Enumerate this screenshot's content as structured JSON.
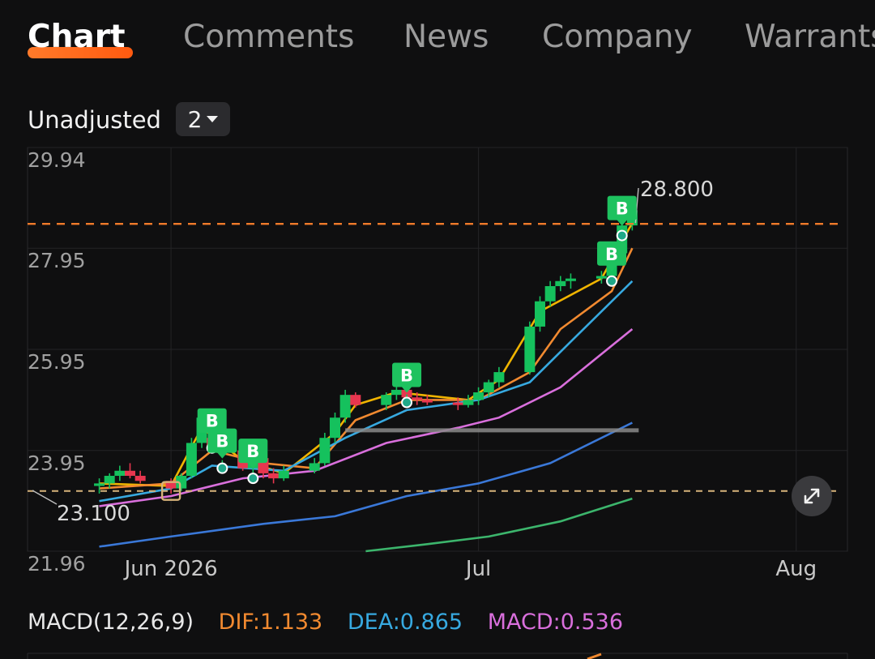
{
  "tabs": [
    {
      "label": "Chart",
      "active": true
    },
    {
      "label": "Comments",
      "active": false
    },
    {
      "label": "News",
      "active": false
    },
    {
      "label": "Company",
      "active": false
    },
    {
      "label": "Warrants",
      "active": false
    }
  ],
  "adjustment": {
    "label": "Unadjusted",
    "period": "2"
  },
  "chart_data": {
    "type": "candlestick",
    "y_axis_ticks": [
      "29.94",
      "27.95",
      "25.95",
      "23.95",
      "21.96"
    ],
    "ylim": [
      21.96,
      29.94
    ],
    "x_axis_ticks": [
      {
        "label": "Jun 2026",
        "x": "2026-06-01"
      },
      {
        "label": "Jul",
        "x": "2026-07-01"
      },
      {
        "label": "Aug",
        "x": "2026-08-01"
      }
    ],
    "high_marker": {
      "label": "28.800",
      "value": 28.8
    },
    "low_marker": {
      "label": "23.100",
      "value": 23.1
    },
    "current_level_line": 23.15,
    "support_line": 24.35,
    "buy_signal_label": "B",
    "buy_signals": [
      {
        "date": "2026-06-05",
        "price": 24.0
      },
      {
        "date": "2026-06-06",
        "price": 23.6
      },
      {
        "date": "2026-06-09",
        "price": 23.4
      },
      {
        "date": "2026-06-24",
        "price": 24.9
      },
      {
        "date": "2026-07-14",
        "price": 27.3
      },
      {
        "date": "2026-07-15",
        "price": 28.2
      }
    ],
    "candles": [
      {
        "date": "2026-05-25",
        "open": 23.25,
        "high": 23.4,
        "low": 23.1,
        "close": 23.3
      },
      {
        "date": "2026-05-26",
        "open": 23.3,
        "high": 23.5,
        "low": 23.2,
        "close": 23.45
      },
      {
        "date": "2026-05-27",
        "open": 23.45,
        "high": 23.65,
        "low": 23.35,
        "close": 23.55
      },
      {
        "date": "2026-05-28",
        "open": 23.55,
        "high": 23.7,
        "low": 23.4,
        "close": 23.45
      },
      {
        "date": "2026-05-29",
        "open": 23.45,
        "high": 23.55,
        "low": 23.3,
        "close": 23.35
      },
      {
        "date": "2026-06-01",
        "open": 23.35,
        "high": 23.4,
        "low": 23.1,
        "close": 23.2
      },
      {
        "date": "2026-06-02",
        "open": 23.2,
        "high": 23.5,
        "low": 23.15,
        "close": 23.45
      },
      {
        "date": "2026-06-03",
        "open": 23.45,
        "high": 24.2,
        "low": 23.4,
        "close": 24.1
      },
      {
        "date": "2026-06-04",
        "open": 24.1,
        "high": 24.75,
        "low": 24.0,
        "close": 24.6
      },
      {
        "date": "2026-06-05",
        "open": 24.2,
        "high": 24.3,
        "low": 23.9,
        "close": 23.95
      },
      {
        "date": "2026-06-08",
        "open": 23.95,
        "high": 24.0,
        "low": 23.55,
        "close": 23.6
      },
      {
        "date": "2026-06-09",
        "open": 23.6,
        "high": 23.85,
        "low": 23.5,
        "close": 23.8
      },
      {
        "date": "2026-06-10",
        "open": 23.8,
        "high": 23.9,
        "low": 23.4,
        "close": 23.5
      },
      {
        "date": "2026-06-11",
        "open": 23.5,
        "high": 23.6,
        "low": 23.3,
        "close": 23.4
      },
      {
        "date": "2026-06-12",
        "open": 23.4,
        "high": 23.65,
        "low": 23.35,
        "close": 23.55
      },
      {
        "date": "2026-06-15",
        "open": 23.55,
        "high": 23.8,
        "low": 23.5,
        "close": 23.7
      },
      {
        "date": "2026-06-16",
        "open": 23.7,
        "high": 24.3,
        "low": 23.65,
        "close": 24.2
      },
      {
        "date": "2026-06-17",
        "open": 24.2,
        "high": 24.7,
        "low": 24.1,
        "close": 24.6
      },
      {
        "date": "2026-06-18",
        "open": 24.6,
        "high": 25.15,
        "low": 24.5,
        "close": 25.05
      },
      {
        "date": "2026-06-19",
        "open": 25.05,
        "high": 25.1,
        "low": 24.8,
        "close": 24.85
      },
      {
        "date": "2026-06-22",
        "open": 24.85,
        "high": 25.1,
        "low": 24.75,
        "close": 25.05
      },
      {
        "date": "2026-06-23",
        "open": 25.05,
        "high": 25.3,
        "low": 24.95,
        "close": 25.15
      },
      {
        "date": "2026-06-24",
        "open": 25.15,
        "high": 25.2,
        "low": 24.95,
        "close": 25.0
      },
      {
        "date": "2026-06-25",
        "open": 25.0,
        "high": 25.1,
        "low": 24.85,
        "close": 24.95
      },
      {
        "date": "2026-06-26",
        "open": 24.95,
        "high": 25.05,
        "low": 24.85,
        "close": 24.9
      },
      {
        "date": "2026-06-29",
        "open": 24.9,
        "high": 25.0,
        "low": 24.75,
        "close": 24.85
      },
      {
        "date": "2026-06-30",
        "open": 24.85,
        "high": 25.05,
        "low": 24.8,
        "close": 24.95
      },
      {
        "date": "2026-07-01",
        "open": 24.95,
        "high": 25.2,
        "low": 24.85,
        "close": 25.1
      },
      {
        "date": "2026-07-02",
        "open": 25.1,
        "high": 25.35,
        "low": 25.0,
        "close": 25.3
      },
      {
        "date": "2026-07-03",
        "open": 25.3,
        "high": 25.6,
        "low": 25.2,
        "close": 25.5
      },
      {
        "date": "2026-07-06",
        "open": 25.5,
        "high": 26.5,
        "low": 25.45,
        "close": 26.4
      },
      {
        "date": "2026-07-07",
        "open": 26.4,
        "high": 27.0,
        "low": 26.3,
        "close": 26.9
      },
      {
        "date": "2026-07-08",
        "open": 26.9,
        "high": 27.3,
        "low": 26.8,
        "close": 27.2
      },
      {
        "date": "2026-07-09",
        "open": 27.2,
        "high": 27.4,
        "low": 27.1,
        "close": 27.3
      },
      {
        "date": "2026-07-10",
        "open": 27.3,
        "high": 27.45,
        "low": 27.15,
        "close": 27.35
      },
      {
        "date": "2026-07-13",
        "open": 27.35,
        "high": 27.5,
        "low": 27.25,
        "close": 27.4
      },
      {
        "date": "2026-07-14",
        "open": 27.4,
        "high": 27.9,
        "low": 27.3,
        "close": 27.85
      },
      {
        "date": "2026-07-15",
        "open": 27.85,
        "high": 28.5,
        "low": 27.8,
        "close": 28.4
      },
      {
        "date": "2026-07-16",
        "open": 28.4,
        "high": 28.8,
        "low": 28.3,
        "close": 28.7
      }
    ],
    "moving_averages": [
      {
        "color": "#f0b400",
        "points": [
          [
            "2026-05-25",
            23.3
          ],
          [
            "2026-06-01",
            23.25
          ],
          [
            "2026-06-04",
            24.4
          ],
          [
            "2026-06-08",
            23.75
          ],
          [
            "2026-06-12",
            23.5
          ],
          [
            "2026-06-17",
            24.3
          ],
          [
            "2026-06-19",
            24.85
          ],
          [
            "2026-06-23",
            25.1
          ],
          [
            "2026-06-30",
            24.95
          ],
          [
            "2026-07-03",
            25.35
          ],
          [
            "2026-07-07",
            26.7
          ],
          [
            "2026-07-13",
            27.35
          ],
          [
            "2026-07-16",
            28.45
          ]
        ]
      },
      {
        "color": "#f28a30",
        "points": [
          [
            "2026-05-25",
            23.2
          ],
          [
            "2026-06-01",
            23.3
          ],
          [
            "2026-06-05",
            23.95
          ],
          [
            "2026-06-10",
            23.7
          ],
          [
            "2026-06-15",
            23.6
          ],
          [
            "2026-06-19",
            24.55
          ],
          [
            "2026-06-24",
            24.95
          ],
          [
            "2026-07-01",
            24.95
          ],
          [
            "2026-07-06",
            25.5
          ],
          [
            "2026-07-09",
            26.35
          ],
          [
            "2026-07-14",
            27.1
          ],
          [
            "2026-07-16",
            27.95
          ]
        ]
      },
      {
        "color": "#37a9e0",
        "points": [
          [
            "2026-05-25",
            22.95
          ],
          [
            "2026-06-01",
            23.2
          ],
          [
            "2026-06-05",
            23.65
          ],
          [
            "2026-06-12",
            23.55
          ],
          [
            "2026-06-18",
            24.2
          ],
          [
            "2026-06-24",
            24.75
          ],
          [
            "2026-07-01",
            24.95
          ],
          [
            "2026-07-06",
            25.3
          ],
          [
            "2026-07-10",
            26.1
          ],
          [
            "2026-07-16",
            27.3
          ]
        ]
      },
      {
        "color": "#d96fdc",
        "points": [
          [
            "2026-05-25",
            22.85
          ],
          [
            "2026-06-01",
            23.05
          ],
          [
            "2026-06-08",
            23.4
          ],
          [
            "2026-06-15",
            23.55
          ],
          [
            "2026-06-22",
            24.1
          ],
          [
            "2026-06-29",
            24.4
          ],
          [
            "2026-07-03",
            24.6
          ],
          [
            "2026-07-09",
            25.2
          ],
          [
            "2026-07-16",
            26.35
          ]
        ]
      },
      {
        "color": "#3a78d8",
        "points": [
          [
            "2026-05-25",
            22.05
          ],
          [
            "2026-06-01",
            22.25
          ],
          [
            "2026-06-10",
            22.5
          ],
          [
            "2026-06-17",
            22.65
          ],
          [
            "2026-06-24",
            23.05
          ],
          [
            "2026-07-01",
            23.3
          ],
          [
            "2026-07-08",
            23.7
          ],
          [
            "2026-07-16",
            24.5
          ]
        ]
      },
      {
        "color": "#3cb56c",
        "points": [
          [
            "2026-06-20",
            21.96
          ],
          [
            "2026-06-26",
            22.1
          ],
          [
            "2026-07-02",
            22.25
          ],
          [
            "2026-07-09",
            22.55
          ],
          [
            "2026-07-16",
            23.0
          ]
        ]
      }
    ]
  },
  "macd": {
    "name": "MACD(12,26,9)",
    "dif": "DIF:1.133",
    "dea": "DEA:0.865",
    "macd": "MACD:0.536"
  },
  "colors": {
    "up": "#15c15d",
    "down": "#e8364f",
    "high_line": "#f07a2a",
    "low_line": "#d7b37a",
    "tab_accent": "#ff6a1a"
  }
}
